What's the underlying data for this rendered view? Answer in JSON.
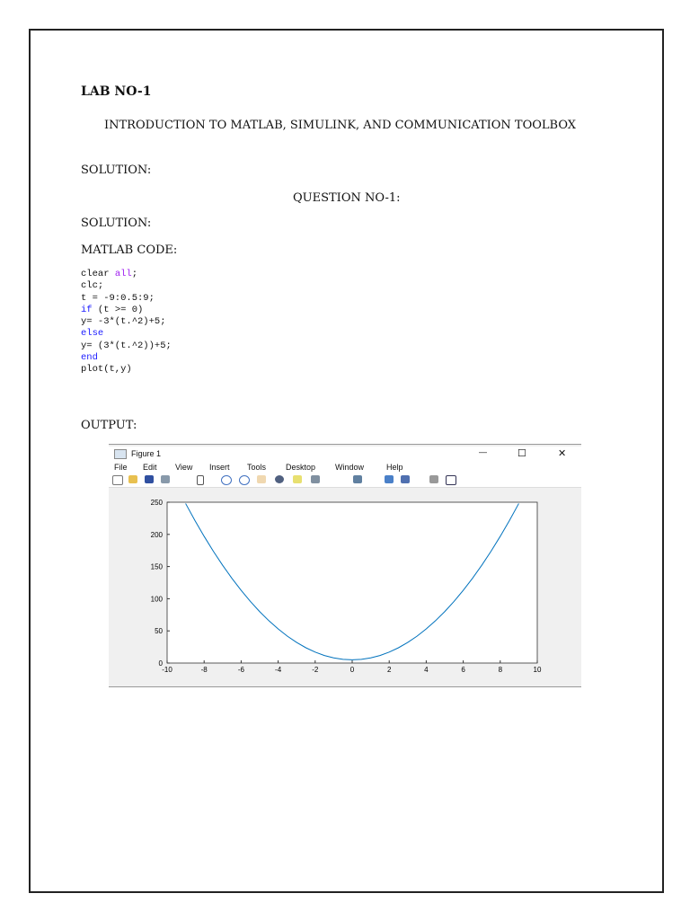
{
  "lab_title": "LAB NO-1",
  "subtitle": "INTRODUCTION TO MATLAB, SIMULINK, AND COMMUNICATION TOOLBOX",
  "solution1": "SOLUTION:",
  "question": "QUESTION NO-1:",
  "solution2": "SOLUTION:",
  "code_heading": "MATLAB CODE:",
  "code": [
    {
      "parts": [
        [
          "clear ",
          ""
        ],
        [
          "all",
          "str"
        ],
        [
          ";",
          ""
        ]
      ]
    },
    {
      "parts": [
        [
          "clc;",
          ""
        ]
      ]
    },
    {
      "parts": [
        [
          "t = -9:0.5:9;",
          ""
        ]
      ]
    },
    {
      "parts": [
        [
          "if",
          "kw"
        ],
        [
          " (t >= 0)",
          ""
        ]
      ]
    },
    {
      "parts": [
        [
          "y= -3*(t.^2)+5;",
          ""
        ]
      ]
    },
    {
      "parts": [
        [
          "else",
          "kw"
        ]
      ]
    },
    {
      "parts": [
        [
          "y= (3*(t.^2))+5;",
          ""
        ]
      ]
    },
    {
      "parts": [
        [
          "end",
          "kw"
        ]
      ]
    },
    {
      "parts": [
        [
          "plot(t,y)",
          ""
        ]
      ]
    }
  ],
  "output_heading": "OUTPUT:",
  "figure": {
    "title": "Figure 1",
    "menu": [
      "File",
      "Edit",
      "View",
      "Insert",
      "Tools",
      "Desktop",
      "Window",
      "Help"
    ],
    "window_controls": {
      "minimize": "—",
      "maximize": "☐",
      "close": "✕"
    }
  },
  "chart_data": {
    "type": "line",
    "title": "",
    "xlabel": "",
    "ylabel": "",
    "xlim": [
      -10,
      10
    ],
    "ylim": [
      0,
      250
    ],
    "xticks": [
      -10,
      -8,
      -6,
      -4,
      -2,
      0,
      2,
      4,
      6,
      8,
      10
    ],
    "yticks": [
      0,
      50,
      100,
      150,
      200,
      250
    ],
    "series": [
      {
        "name": "y",
        "color": "#0072bd",
        "formula": "3*t^2+5",
        "t_start": -9,
        "t_step": 0.5,
        "t_end": 9
      }
    ]
  }
}
